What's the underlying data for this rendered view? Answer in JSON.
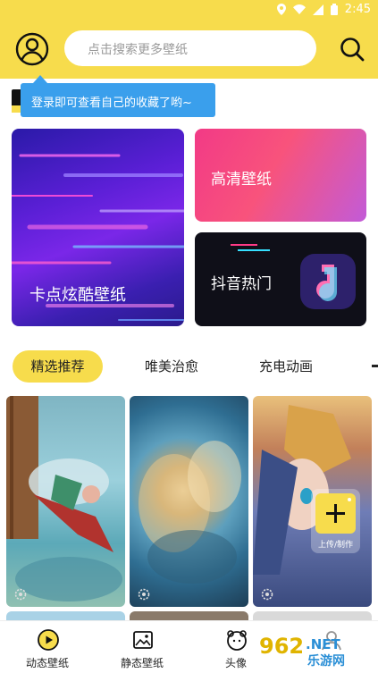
{
  "status": {
    "time": "2:45"
  },
  "header": {
    "search_placeholder": "点击搜索更多壁纸"
  },
  "tooltip": {
    "text": "登录即可查看自己的收藏了哟~"
  },
  "features": [
    {
      "label": "卡点炫酷壁纸"
    },
    {
      "label": "高清壁纸"
    },
    {
      "label": "抖音热门"
    }
  ],
  "tabs": [
    {
      "label": "精选推荐",
      "active": true
    },
    {
      "label": "唯美治愈"
    },
    {
      "label": "充电动画"
    }
  ],
  "fab": {
    "label": "上传/制作"
  },
  "bottom_nav": [
    {
      "label": "动态壁纸"
    },
    {
      "label": "静态壁纸"
    },
    {
      "label": "头像"
    }
  ],
  "colors": {
    "accent": "#f7dc4c",
    "tooltip": "#3a9fec"
  }
}
